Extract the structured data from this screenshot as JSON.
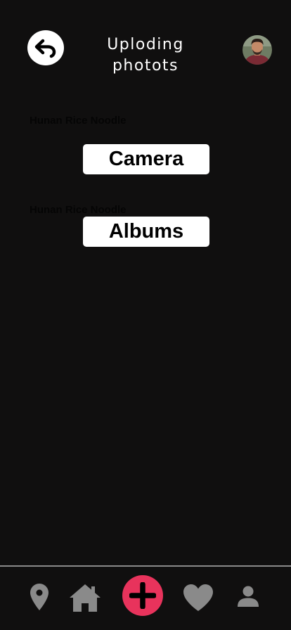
{
  "header": {
    "title": "Uploding photots",
    "back_icon": "back-arrow-icon",
    "avatar_icon": "user-avatar"
  },
  "background_labels": [
    "Hunan Rice Noodle",
    "Hunan Rice Noodle"
  ],
  "options": {
    "camera_label": "Camera",
    "albums_label": "Albums"
  },
  "bottom_nav": {
    "items": [
      "location-pin-icon",
      "home-icon",
      "add-icon",
      "heart-icon",
      "person-icon"
    ]
  },
  "colors": {
    "background": "#100f0f",
    "accent": "#e8335c",
    "nav_icon": "#8a8a8a",
    "button_bg": "#ffffff"
  }
}
